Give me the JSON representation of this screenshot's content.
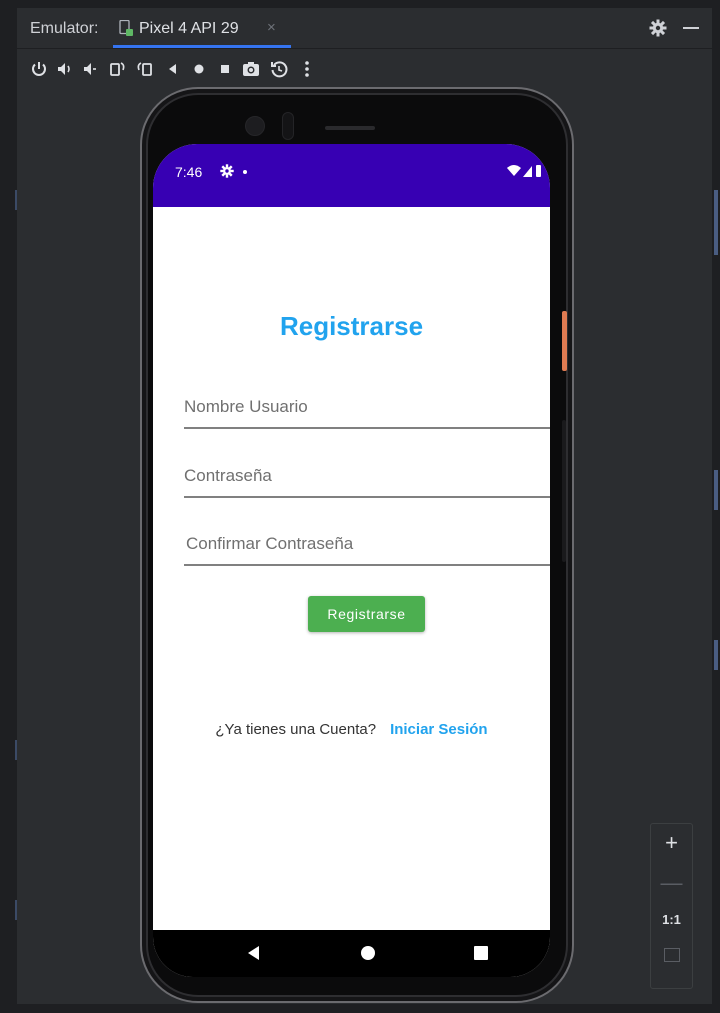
{
  "tabbar": {
    "emulator_label": "Emulator:",
    "tab_label": "Pixel 4 API 29",
    "tab_close": "×"
  },
  "toolbar": {
    "buttons": [
      "power-icon",
      "volume-up-icon",
      "volume-down-icon",
      "rotate-left-icon",
      "rotate-right-icon",
      "back-icon",
      "home-icon",
      "overview-icon",
      "screenshot-icon",
      "snapshot-icon",
      "more-icon"
    ]
  },
  "device": {
    "status_time": "7:46"
  },
  "app": {
    "title": "Registrarse",
    "fields": {
      "username_placeholder": "Nombre Usuario",
      "password_placeholder": "Contraseña",
      "confirm_placeholder": "Confirmar Contraseña"
    },
    "register_button": "Registrarse",
    "account_prompt": "¿Ya tienes una Cuenta?",
    "login_link": "Iniciar Sesión"
  },
  "zoom": {
    "plus": "+",
    "minus": "—",
    "one_to_one": "1:1"
  },
  "colors": {
    "status_bar": "#3700b3",
    "title": "#21a3ee",
    "button": "#4caf50",
    "link": "#21a3ee",
    "tab_underline": "#3574f0"
  }
}
